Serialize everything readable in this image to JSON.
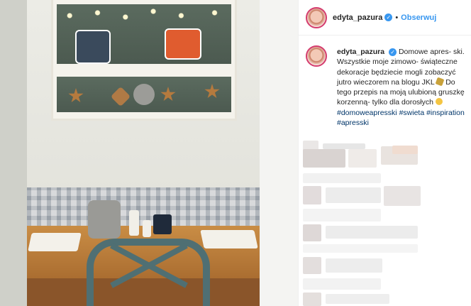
{
  "header": {
    "username": "edyta_pazura",
    "separator": "•",
    "follow_label": "Obserwuj"
  },
  "post": {
    "username": "edyta_pazura",
    "caption_text": "Domowe apres- ski. Wszystkie moje zimowo- świąteczne dekoracje będziecie mogli zobaczyć jutro wieczorem na blogu JKL",
    "caption_text_2": "Do tego przepis na moją ulubioną gruszkę korzenną- tylko dla dorosłych",
    "hashtags": [
      "#domoweapresski",
      "#swieta",
      "#inspiration",
      "#apresski"
    ]
  },
  "colors": {
    "link": "#3897f0",
    "hashtag": "#003569",
    "text": "#262626",
    "avatar_ring": "#d43c6e"
  },
  "icons": [
    "verified-badge-icon",
    "smile-emoji-icon",
    "bird-emoji-icon"
  ]
}
